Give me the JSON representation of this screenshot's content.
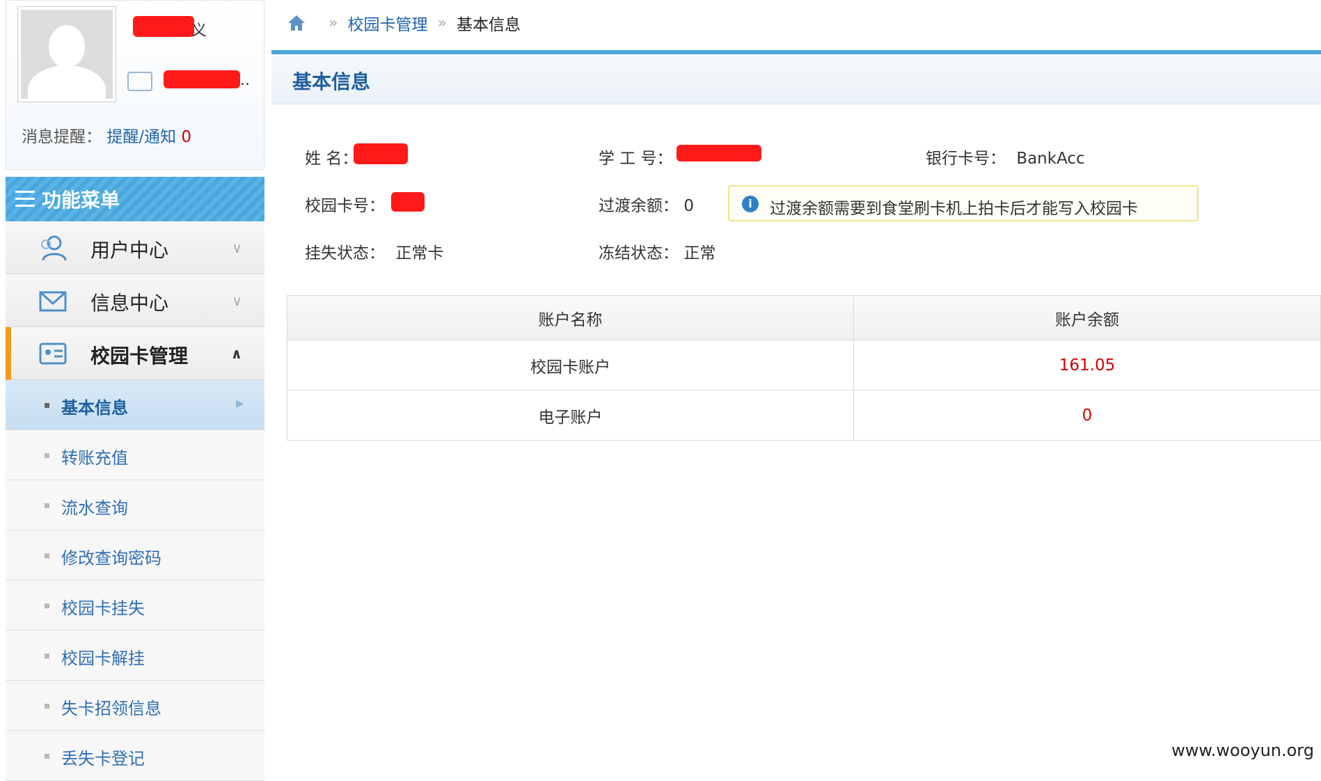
{
  "profile": {
    "name_suffix": "义",
    "id_suffix": "..",
    "msg_label": "消息提醒：",
    "msg_link": "提醒/通知",
    "msg_count": "0"
  },
  "menu": {
    "header": "功能菜单",
    "items": [
      {
        "label": "用户中心",
        "icon": "user-icon",
        "chevron": "∨"
      },
      {
        "label": "信息中心",
        "icon": "mail-icon",
        "chevron": "∨"
      },
      {
        "label": "校园卡管理",
        "icon": "card-icon",
        "chevron": "∧"
      }
    ],
    "sub_items": [
      {
        "label": "基本信息"
      },
      {
        "label": "转账充值"
      },
      {
        "label": "流水查询"
      },
      {
        "label": "修改查询密码"
      },
      {
        "label": "校园卡挂失"
      },
      {
        "label": "校园卡解挂"
      },
      {
        "label": "失卡招领信息"
      },
      {
        "label": "丢失卡登记"
      }
    ]
  },
  "breadcrumb": {
    "sep": "»",
    "level1": "校园卡管理",
    "level2": "基本信息"
  },
  "panel": {
    "title": "基本信息",
    "fields": {
      "name_label": "姓  名：",
      "student_id_label": "学 工 号：",
      "bank_label": "银行卡号：",
      "bank_value": "BankAcc",
      "card_label": "校园卡号：",
      "transition_label": "过渡余额：",
      "transition_value": "0",
      "loss_label": "挂失状态：",
      "loss_value": "正常卡",
      "freeze_label": "冻结状态：",
      "freeze_value": "正常"
    },
    "notice": "过渡余额需要到食堂刷卡机上拍卡后才能写入校园卡",
    "table": {
      "headers": [
        "账户名称",
        "账户余额"
      ],
      "rows": [
        {
          "name": "校园卡账户",
          "balance": "161.05"
        },
        {
          "name": "电子账户",
          "balance": "0"
        }
      ]
    }
  },
  "watermark": "www.wooyun.org",
  "colors": {
    "accent": "#4aa6dc",
    "active_bar": "#f39a1e",
    "link": "#1e64a8",
    "balance": "#d40000"
  }
}
